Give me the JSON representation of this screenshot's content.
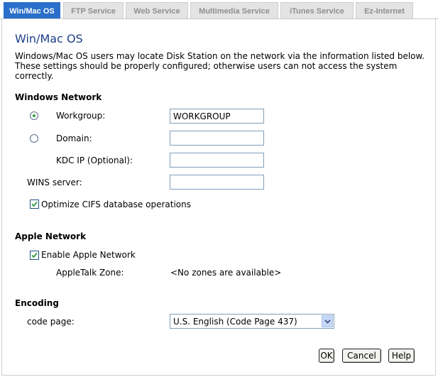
{
  "tabs": [
    {
      "label": "Win/Mac OS",
      "active": true
    },
    {
      "label": "FTP Service",
      "active": false
    },
    {
      "label": "Web Service",
      "active": false
    },
    {
      "label": "Multimedia Service",
      "active": false
    },
    {
      "label": "iTunes Service",
      "active": false
    },
    {
      "label": "Ez-Internet",
      "active": false
    }
  ],
  "page": {
    "title": "Win/Mac OS",
    "description": "Windows/Mac OS users may locate Disk Station on the network via the information listed below. These settings should be properly configured; otherwise users can not access the system correctly."
  },
  "windows_network": {
    "heading": "Windows Network",
    "workgroup_label": "Workgroup:",
    "workgroup_value": "WORKGROUP",
    "workgroup_selected": true,
    "domain_label": "Domain:",
    "domain_value": "",
    "kdc_label": "KDC IP (Optional):",
    "kdc_value": "",
    "wins_label": "WINS server:",
    "wins_value": "",
    "optimize_label": "Optimize CIFS database operations",
    "optimize_checked": true
  },
  "apple_network": {
    "heading": "Apple Network",
    "enable_label": "Enable Apple Network",
    "enable_checked": true,
    "zone_label": "AppleTalk Zone:",
    "zone_value": "<No zones are available>"
  },
  "encoding": {
    "heading": "Encoding",
    "code_page_label": "code page:",
    "code_page_value": "U.S. English (Code Page 437)"
  },
  "buttons": {
    "ok": "OK",
    "cancel": "Cancel",
    "help": "Help"
  },
  "colors": {
    "active_tab": "#2a6fc9",
    "inactive_tab": "#e4e4e4",
    "title": "#1c3f8a",
    "check": "#2f9e3a"
  }
}
